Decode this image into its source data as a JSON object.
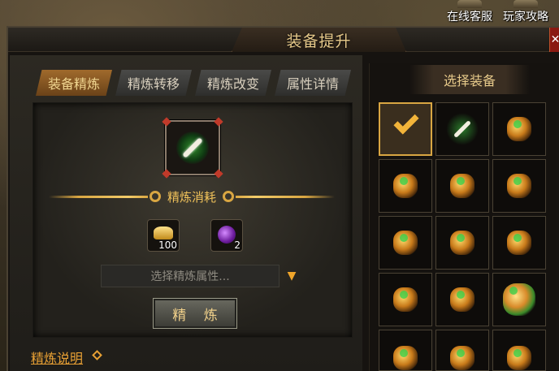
{
  "shortcuts": [
    {
      "label": "在线客服",
      "icon": "headset-icon"
    },
    {
      "label": "玩家攻略",
      "icon": "guide-book-icon"
    }
  ],
  "window": {
    "title": "装备提升",
    "close_icon": "close-icon"
  },
  "tabs": [
    {
      "label": "装备精炼",
      "active": true
    },
    {
      "label": "精炼转移",
      "active": false
    },
    {
      "label": "精炼改变",
      "active": false
    },
    {
      "label": "属性详情",
      "active": false
    }
  ],
  "refine": {
    "target_item_icon": "bone-weapon-icon",
    "cost_title": "精炼消耗",
    "costs": [
      {
        "icon": "gold-ingot-icon",
        "count": "100"
      },
      {
        "icon": "purple-orb-icon",
        "count": "2"
      }
    ],
    "attribute_placeholder": "选择精炼属性...",
    "refine_button": "精 炼",
    "help_link": "精炼说明"
  },
  "selection": {
    "header": "选择装备",
    "items": [
      {
        "icon": "checkmark-icon",
        "selected": true
      },
      {
        "icon": "bone-weapon-icon",
        "selected": false
      },
      {
        "icon": "gem-pile-icon",
        "selected": false
      },
      {
        "icon": "gem-pile-icon",
        "selected": false
      },
      {
        "icon": "gem-pile-icon",
        "selected": false
      },
      {
        "icon": "gem-pile-icon",
        "selected": false
      },
      {
        "icon": "gem-pile-icon",
        "selected": false
      },
      {
        "icon": "gem-pile-icon",
        "selected": false
      },
      {
        "icon": "gem-pile-icon",
        "selected": false
      },
      {
        "icon": "gem-pile-icon",
        "selected": false
      },
      {
        "icon": "gem-pile-icon",
        "selected": false
      },
      {
        "icon": "treasure-chest-icon",
        "selected": false
      },
      {
        "icon": "gem-pile-icon",
        "selected": false
      },
      {
        "icon": "gem-pile-icon",
        "selected": false
      },
      {
        "icon": "torch-icon",
        "selected": false
      }
    ]
  }
}
